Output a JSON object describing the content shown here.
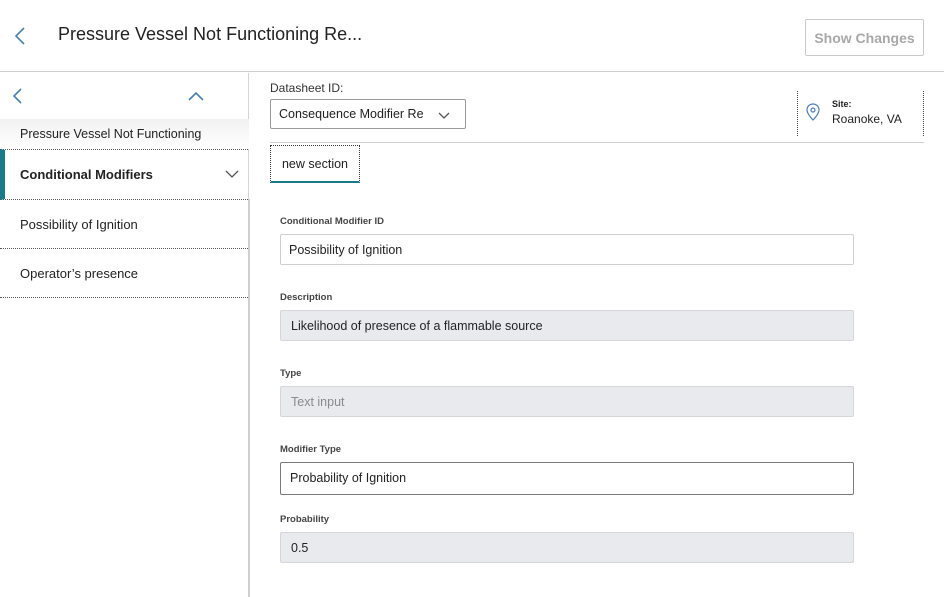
{
  "header": {
    "title": "Pressure Vessel Not Functioning Re...",
    "show_changes_label": "Show Changes"
  },
  "left_panel": {
    "record_title": "Pressure Vessel Not Functioning",
    "items": [
      {
        "label": "Conditional Modifiers",
        "active": true
      },
      {
        "label": "Possibility of Ignition",
        "active": false
      },
      {
        "label": "Operator’s presence",
        "active": false
      }
    ]
  },
  "datasheet": {
    "label": "Datasheet ID:",
    "selected": "Consequence Modifier Re"
  },
  "site": {
    "label": "Site:",
    "value": "Roanoke, VA"
  },
  "tabs": [
    {
      "label": "new section"
    }
  ],
  "form": {
    "fields": [
      {
        "label": "Conditional Modifier ID",
        "value": "Possibility of Ignition"
      },
      {
        "label": "Description",
        "value": "Likelihood of presence of a flammable source"
      },
      {
        "label": "Type",
        "value": "Text input"
      },
      {
        "label": "Modifier Type",
        "value": "Probability of Ignition"
      },
      {
        "label": "Probability",
        "value": "0.5"
      }
    ]
  },
  "colors": {
    "accent": "#1a7a8a",
    "readonly_bg": "#e8eaee",
    "icon_blue": "#4a7fb5"
  },
  "icons": {
    "back": "chevron-left-icon",
    "collapse": "chevron-up-icon",
    "expand": "chevron-down-icon",
    "site": "map-pin-icon"
  }
}
